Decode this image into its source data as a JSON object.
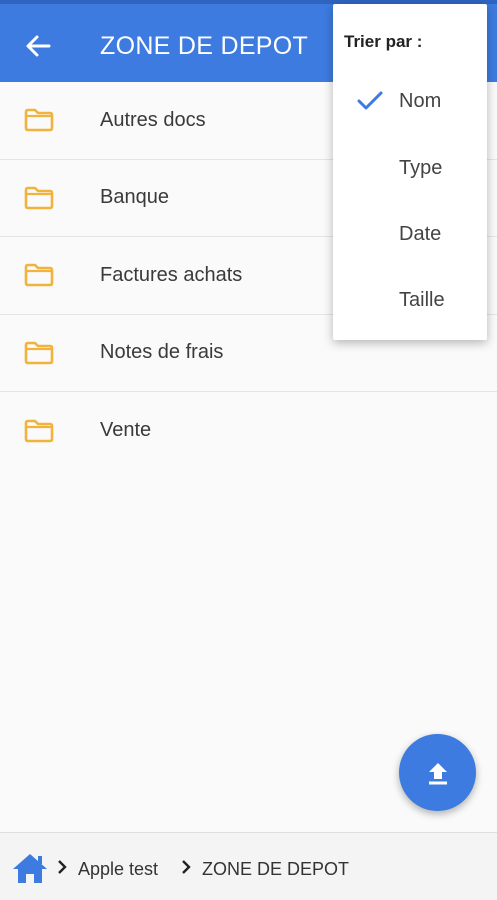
{
  "header": {
    "title": "ZONE DE DEPOT",
    "back_icon": "arrow-back-icon",
    "background": "#3d7be0"
  },
  "folders": [
    {
      "name": "Autres docs",
      "icon": "folder-icon"
    },
    {
      "name": "Banque",
      "icon": "folder-icon"
    },
    {
      "name": "Factures achats",
      "icon": "folder-icon"
    },
    {
      "name": "Notes de frais",
      "icon": "folder-icon"
    },
    {
      "name": "Vente",
      "icon": "folder-icon"
    }
  ],
  "sort_menu": {
    "title": "Trier par :",
    "options": [
      {
        "label": "Nom",
        "selected": true
      },
      {
        "label": "Type",
        "selected": false
      },
      {
        "label": "Date",
        "selected": false
      },
      {
        "label": "Taille",
        "selected": false
      }
    ]
  },
  "fab": {
    "icon": "upload-icon"
  },
  "breadcrumb": {
    "home_icon": "home-icon",
    "items": [
      "Apple test",
      "ZONE DE DEPOT"
    ]
  },
  "colors": {
    "accent": "#3d7be0",
    "folder": "#f2b33d"
  }
}
